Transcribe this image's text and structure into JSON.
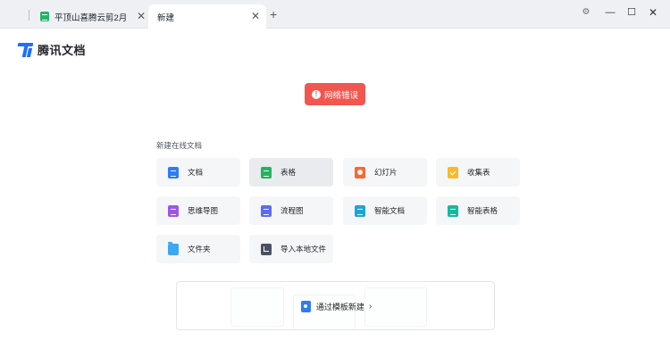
{
  "tabs": [
    {
      "title": "平顶山喜腾云剪2月",
      "close": "✕"
    },
    {
      "title": "新建",
      "close": "✕"
    }
  ],
  "new_tab": "+",
  "window_controls": {
    "gear": "⚙",
    "minimize": "—",
    "maximize": "☐",
    "close": "✕"
  },
  "logo": {
    "text": "腾讯文档"
  },
  "error_badge": {
    "icon": "!",
    "text": "网络错误"
  },
  "section": {
    "title": "新建在线文档",
    "items": [
      {
        "label": "文档",
        "icon": "doc-icon"
      },
      {
        "label": "表格",
        "icon": "sheet-icon"
      },
      {
        "label": "幻灯片",
        "icon": "slides-icon"
      },
      {
        "label": "收集表",
        "icon": "form-icon"
      },
      {
        "label": "思维导图",
        "icon": "mindmap-icon"
      },
      {
        "label": "流程图",
        "icon": "flowchart-icon"
      },
      {
        "label": "智能文档",
        "icon": "smart-doc-icon"
      },
      {
        "label": "智能表格",
        "icon": "smart-sheet-icon"
      },
      {
        "label": "文件夹",
        "icon": "folder-icon"
      },
      {
        "label": "导入本地文件",
        "icon": "import-icon"
      }
    ]
  },
  "template": {
    "label": "通过模板新建",
    "arrow": "›"
  },
  "colors": {
    "accent": "#1e6fff",
    "error": "#f1574f",
    "sheet": "#22b35e"
  }
}
